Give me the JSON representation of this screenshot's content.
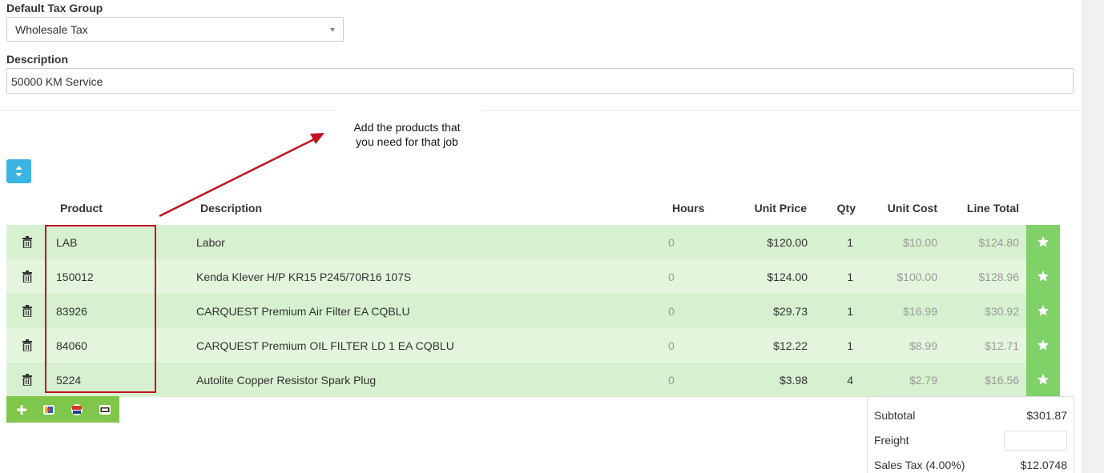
{
  "form": {
    "tax_group_label": "Default Tax Group",
    "tax_group_value": "Wholesale Tax",
    "description_label": "Description",
    "description_value": "50000 KM Service"
  },
  "annotation": {
    "callout_line1": "Add the products that",
    "callout_line2": "you need for that job",
    "arrow_color": "#c1121f"
  },
  "table": {
    "headers": {
      "product": "Product",
      "description": "Description",
      "hours": "Hours",
      "unit_price": "Unit Price",
      "qty": "Qty",
      "unit_cost": "Unit Cost",
      "line_total": "Line Total"
    },
    "rows": [
      {
        "product": "LAB",
        "description": "Labor",
        "hours": "0",
        "unit_price": "$120.00",
        "qty": "1",
        "unit_cost": "$10.00",
        "line_total": "$124.80"
      },
      {
        "product": "150012",
        "description": "Kenda Klever H/P KR15 P245/70R16 107S",
        "hours": "0",
        "unit_price": "$124.00",
        "qty": "1",
        "unit_cost": "$100.00",
        "line_total": "$128.96"
      },
      {
        "product": "83926",
        "description": "CARQUEST Premium Air Filter EA CQBLU",
        "hours": "0",
        "unit_price": "$29.73",
        "qty": "1",
        "unit_cost": "$16.99",
        "line_total": "$30.92"
      },
      {
        "product": "84060",
        "description": "CARQUEST Premium OIL FILTER LD 1 EA CQBLU",
        "hours": "0",
        "unit_price": "$12.22",
        "qty": "1",
        "unit_cost": "$8.99",
        "line_total": "$12.71"
      },
      {
        "product": "5224",
        "description": "Autolite Copper Resistor Spark Plug",
        "hours": "0",
        "unit_price": "$3.98",
        "qty": "4",
        "unit_cost": "$2.79",
        "line_total": "$16.56"
      }
    ]
  },
  "totals": {
    "subtotal_label": "Subtotal",
    "subtotal_value": "$301.87",
    "freight_label": "Freight",
    "freight_value": "",
    "sales_tax_label": "Sales Tax (4.00%)",
    "sales_tax_value": "$12.0748"
  },
  "icons": {
    "sort_toggle": "sort-icon",
    "delete": "trash-icon",
    "favorite": "star-icon",
    "add": "plus-icon"
  },
  "colors": {
    "row_even": "#d7f0cf",
    "row_odd": "#e4f5dd",
    "star_cell": "#7fd168",
    "toolbar_green": "#7fc64b",
    "toggle_blue": "#3ab4e0"
  }
}
